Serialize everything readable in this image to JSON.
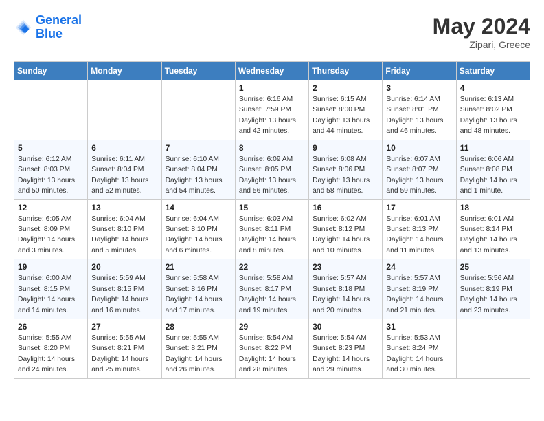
{
  "header": {
    "logo_line1": "General",
    "logo_line2": "Blue",
    "month": "May 2024",
    "location": "Zipari, Greece"
  },
  "weekdays": [
    "Sunday",
    "Monday",
    "Tuesday",
    "Wednesday",
    "Thursday",
    "Friday",
    "Saturday"
  ],
  "weeks": [
    [
      {
        "day": "",
        "sunrise": "",
        "sunset": "",
        "daylight": ""
      },
      {
        "day": "",
        "sunrise": "",
        "sunset": "",
        "daylight": ""
      },
      {
        "day": "",
        "sunrise": "",
        "sunset": "",
        "daylight": ""
      },
      {
        "day": "1",
        "sunrise": "Sunrise: 6:16 AM",
        "sunset": "Sunset: 7:59 PM",
        "daylight": "Daylight: 13 hours and 42 minutes."
      },
      {
        "day": "2",
        "sunrise": "Sunrise: 6:15 AM",
        "sunset": "Sunset: 8:00 PM",
        "daylight": "Daylight: 13 hours and 44 minutes."
      },
      {
        "day": "3",
        "sunrise": "Sunrise: 6:14 AM",
        "sunset": "Sunset: 8:01 PM",
        "daylight": "Daylight: 13 hours and 46 minutes."
      },
      {
        "day": "4",
        "sunrise": "Sunrise: 6:13 AM",
        "sunset": "Sunset: 8:02 PM",
        "daylight": "Daylight: 13 hours and 48 minutes."
      }
    ],
    [
      {
        "day": "5",
        "sunrise": "Sunrise: 6:12 AM",
        "sunset": "Sunset: 8:03 PM",
        "daylight": "Daylight: 13 hours and 50 minutes."
      },
      {
        "day": "6",
        "sunrise": "Sunrise: 6:11 AM",
        "sunset": "Sunset: 8:04 PM",
        "daylight": "Daylight: 13 hours and 52 minutes."
      },
      {
        "day": "7",
        "sunrise": "Sunrise: 6:10 AM",
        "sunset": "Sunset: 8:04 PM",
        "daylight": "Daylight: 13 hours and 54 minutes."
      },
      {
        "day": "8",
        "sunrise": "Sunrise: 6:09 AM",
        "sunset": "Sunset: 8:05 PM",
        "daylight": "Daylight: 13 hours and 56 minutes."
      },
      {
        "day": "9",
        "sunrise": "Sunrise: 6:08 AM",
        "sunset": "Sunset: 8:06 PM",
        "daylight": "Daylight: 13 hours and 58 minutes."
      },
      {
        "day": "10",
        "sunrise": "Sunrise: 6:07 AM",
        "sunset": "Sunset: 8:07 PM",
        "daylight": "Daylight: 13 hours and 59 minutes."
      },
      {
        "day": "11",
        "sunrise": "Sunrise: 6:06 AM",
        "sunset": "Sunset: 8:08 PM",
        "daylight": "Daylight: 14 hours and 1 minute."
      }
    ],
    [
      {
        "day": "12",
        "sunrise": "Sunrise: 6:05 AM",
        "sunset": "Sunset: 8:09 PM",
        "daylight": "Daylight: 14 hours and 3 minutes."
      },
      {
        "day": "13",
        "sunrise": "Sunrise: 6:04 AM",
        "sunset": "Sunset: 8:10 PM",
        "daylight": "Daylight: 14 hours and 5 minutes."
      },
      {
        "day": "14",
        "sunrise": "Sunrise: 6:04 AM",
        "sunset": "Sunset: 8:10 PM",
        "daylight": "Daylight: 14 hours and 6 minutes."
      },
      {
        "day": "15",
        "sunrise": "Sunrise: 6:03 AM",
        "sunset": "Sunset: 8:11 PM",
        "daylight": "Daylight: 14 hours and 8 minutes."
      },
      {
        "day": "16",
        "sunrise": "Sunrise: 6:02 AM",
        "sunset": "Sunset: 8:12 PM",
        "daylight": "Daylight: 14 hours and 10 minutes."
      },
      {
        "day": "17",
        "sunrise": "Sunrise: 6:01 AM",
        "sunset": "Sunset: 8:13 PM",
        "daylight": "Daylight: 14 hours and 11 minutes."
      },
      {
        "day": "18",
        "sunrise": "Sunrise: 6:01 AM",
        "sunset": "Sunset: 8:14 PM",
        "daylight": "Daylight: 14 hours and 13 minutes."
      }
    ],
    [
      {
        "day": "19",
        "sunrise": "Sunrise: 6:00 AM",
        "sunset": "Sunset: 8:15 PM",
        "daylight": "Daylight: 14 hours and 14 minutes."
      },
      {
        "day": "20",
        "sunrise": "Sunrise: 5:59 AM",
        "sunset": "Sunset: 8:15 PM",
        "daylight": "Daylight: 14 hours and 16 minutes."
      },
      {
        "day": "21",
        "sunrise": "Sunrise: 5:58 AM",
        "sunset": "Sunset: 8:16 PM",
        "daylight": "Daylight: 14 hours and 17 minutes."
      },
      {
        "day": "22",
        "sunrise": "Sunrise: 5:58 AM",
        "sunset": "Sunset: 8:17 PM",
        "daylight": "Daylight: 14 hours and 19 minutes."
      },
      {
        "day": "23",
        "sunrise": "Sunrise: 5:57 AM",
        "sunset": "Sunset: 8:18 PM",
        "daylight": "Daylight: 14 hours and 20 minutes."
      },
      {
        "day": "24",
        "sunrise": "Sunrise: 5:57 AM",
        "sunset": "Sunset: 8:19 PM",
        "daylight": "Daylight: 14 hours and 21 minutes."
      },
      {
        "day": "25",
        "sunrise": "Sunrise: 5:56 AM",
        "sunset": "Sunset: 8:19 PM",
        "daylight": "Daylight: 14 hours and 23 minutes."
      }
    ],
    [
      {
        "day": "26",
        "sunrise": "Sunrise: 5:55 AM",
        "sunset": "Sunset: 8:20 PM",
        "daylight": "Daylight: 14 hours and 24 minutes."
      },
      {
        "day": "27",
        "sunrise": "Sunrise: 5:55 AM",
        "sunset": "Sunset: 8:21 PM",
        "daylight": "Daylight: 14 hours and 25 minutes."
      },
      {
        "day": "28",
        "sunrise": "Sunrise: 5:55 AM",
        "sunset": "Sunset: 8:21 PM",
        "daylight": "Daylight: 14 hours and 26 minutes."
      },
      {
        "day": "29",
        "sunrise": "Sunrise: 5:54 AM",
        "sunset": "Sunset: 8:22 PM",
        "daylight": "Daylight: 14 hours and 28 minutes."
      },
      {
        "day": "30",
        "sunrise": "Sunrise: 5:54 AM",
        "sunset": "Sunset: 8:23 PM",
        "daylight": "Daylight: 14 hours and 29 minutes."
      },
      {
        "day": "31",
        "sunrise": "Sunrise: 5:53 AM",
        "sunset": "Sunset: 8:24 PM",
        "daylight": "Daylight: 14 hours and 30 minutes."
      },
      {
        "day": "",
        "sunrise": "",
        "sunset": "",
        "daylight": ""
      }
    ]
  ]
}
